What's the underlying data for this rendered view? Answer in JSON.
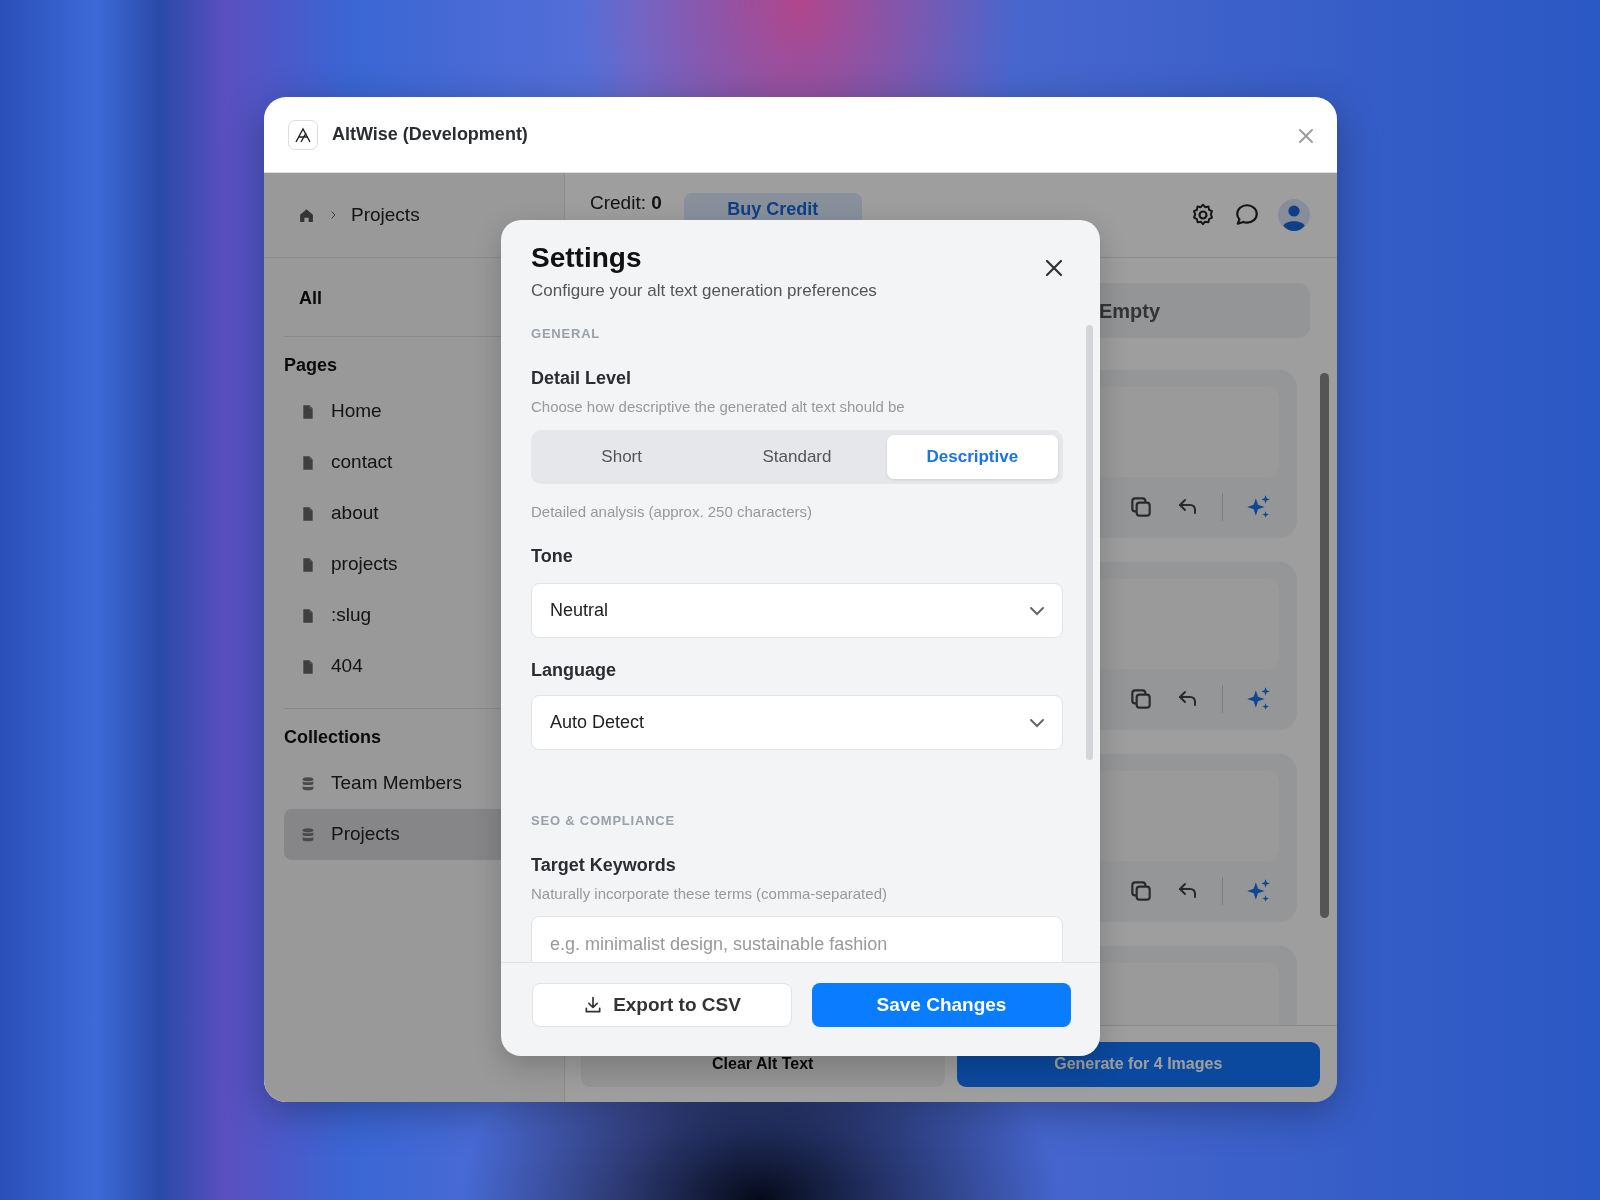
{
  "window": {
    "title": "AltWise (Development)"
  },
  "breadcrumb": {
    "current": "Projects"
  },
  "sidebar": {
    "all": "All",
    "sections": [
      {
        "title": "Pages",
        "kind": "page",
        "items": [
          {
            "label": "Home",
            "selected": false
          },
          {
            "label": "contact",
            "selected": false
          },
          {
            "label": "about",
            "selected": false
          },
          {
            "label": "projects",
            "selected": false
          },
          {
            "label": ":slug",
            "selected": false
          },
          {
            "label": "404",
            "selected": false
          }
        ]
      },
      {
        "title": "Collections",
        "kind": "collection",
        "items": [
          {
            "label": "Team Members",
            "selected": false
          },
          {
            "label": "Projects",
            "selected": true
          }
        ]
      }
    ]
  },
  "topbar": {
    "credit": "Credit: **0**",
    "buy_button": "Buy Credit"
  },
  "filter": {
    "label": "Empty"
  },
  "image_cards": [
    {
      "kind": "image"
    },
    {
      "kind": "image"
    },
    {
      "kind": "image"
    },
    {
      "kind": "image"
    }
  ],
  "footer_buttons": {
    "clear": "Clear Alt Text",
    "generate": "Generate for 4 Images"
  },
  "settings_dialog": {
    "title": "Settings",
    "subtitle": "Configure your alt text generation preferences",
    "sections": [
      {
        "title": "GENERAL",
        "fields": [
          {
            "kind": "segmented",
            "label": "Detail Level",
            "help": "Choose how descriptive the generated alt text should be",
            "options": [
              {
                "label": "Short",
                "selected": false
              },
              {
                "label": "Standard",
                "selected": false
              },
              {
                "label": "Descriptive",
                "selected": true
              }
            ],
            "note": "Detailed analysis (approx. 250 characters)"
          },
          {
            "kind": "select",
            "label": "Tone",
            "value": "Neutral"
          },
          {
            "kind": "select",
            "label": "Language",
            "value": "Auto Detect"
          }
        ]
      },
      {
        "title": "SEO & COMPLIANCE",
        "fields": [
          {
            "kind": "text",
            "label": "Target Keywords",
            "help": "Naturally incorporate these terms (comma-separated)",
            "placeholder": "e.g. minimalist design, sustainable fashion"
          }
        ]
      }
    ],
    "buttons": {
      "export": "Export to CSV",
      "save": "Save Changes"
    }
  }
}
